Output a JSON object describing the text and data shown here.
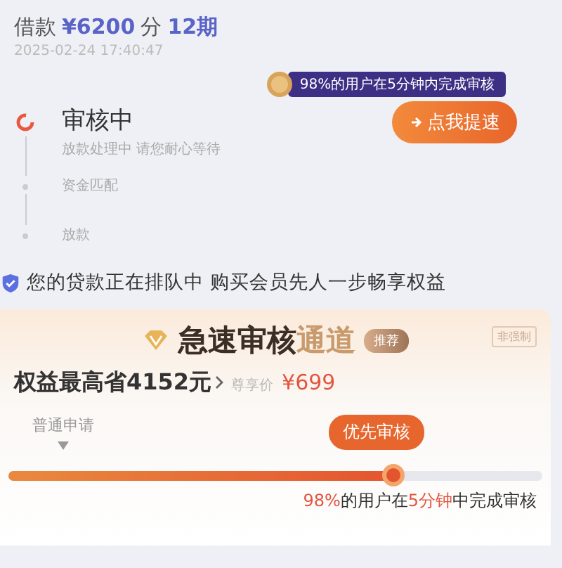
{
  "loan": {
    "label": "借款",
    "amount": "¥6200",
    "term_prefix": "分",
    "term": "12期",
    "time": "2025-02-24 17:40:47"
  },
  "tip": "98%的用户在5分钟内完成审核",
  "speed_button": "点我提速",
  "steps": [
    {
      "title": "审核中",
      "subtitle": "放款处理中 请您耐心等待",
      "active": true
    },
    {
      "title": "资金匹配",
      "active": false
    },
    {
      "title": "放款",
      "active": false
    }
  ],
  "notice": "您的贷款正在排队中 购买会员先人一步畅享权益",
  "vip": {
    "title": "急速审核",
    "title_accent": "通道",
    "tag": "推荐",
    "corner": "非强制",
    "benefit": "权益最高省4152元",
    "price_label": "尊享价",
    "price": "¥699"
  },
  "queue": {
    "normal_label": "普通申请",
    "priority_label": "优先审核",
    "level": 0.72
  },
  "footer": {
    "parts": [
      "98%",
      "的用户在",
      "5分钟",
      "中完成审核"
    ]
  }
}
